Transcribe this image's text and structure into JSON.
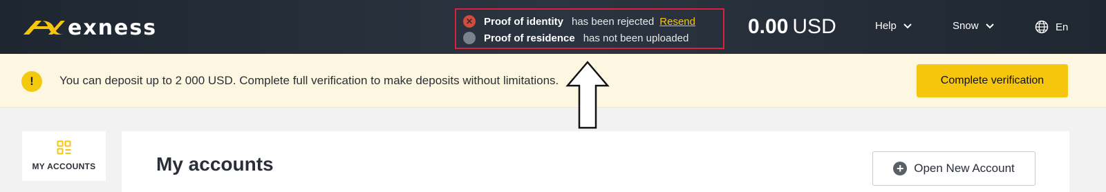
{
  "header": {
    "logo_text": "exness",
    "verification": {
      "identity": {
        "label": "Proof of identity",
        "status": "has been rejected",
        "action": "Resend",
        "status_color": "#d24b3c"
      },
      "residence": {
        "label": "Proof of residence",
        "status": "has not been uploaded",
        "status_color": "#7b828b"
      }
    },
    "balance": {
      "amount": "0.00",
      "currency": "USD"
    },
    "menu": {
      "help": "Help",
      "user": "Snow",
      "language": "En"
    }
  },
  "notice": {
    "icon": "!",
    "text": "You can deposit up to 2 000 USD. Complete full verification to make deposits without limitations.",
    "button": "Complete verification",
    "accent_color": "#f6c60f"
  },
  "sidebar": {
    "items": [
      {
        "label": "MY ACCOUNTS",
        "icon": "accounts-grid-icon"
      }
    ]
  },
  "main": {
    "title": "My accounts",
    "open_account_button": "Open New Account"
  },
  "colors": {
    "header_bg": "#252d37",
    "brand_yellow": "#f6c60f",
    "annotation_red": "#d8213a"
  }
}
